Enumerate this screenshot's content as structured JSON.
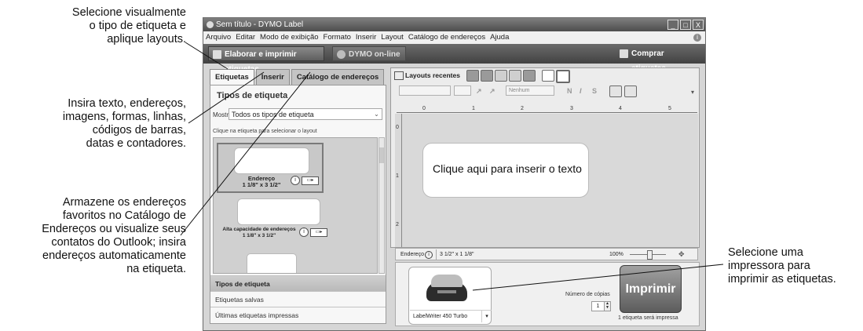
{
  "callouts": {
    "tabs": [
      "Selecione visualmente",
      "o tipo de etiqueta e",
      "aplique layouts."
    ],
    "insert": [
      "Insira texto, endereços,",
      "imagens, formas, linhas,",
      "códigos de barras,",
      "datas e contadores."
    ],
    "addressbook": [
      "Armazene os endereços",
      "favoritos no Catálogo de",
      "Endereços ou visualize seus",
      "contatos do Outlook; insira",
      "endereços automaticamente",
      "na etiqueta."
    ],
    "printer": [
      "Selecione uma",
      "impressora para",
      "imprimir as etiquetas."
    ]
  },
  "window": {
    "title": "Sem título - DYMO Label",
    "controls": [
      "_",
      "□",
      "X"
    ]
  },
  "menu": [
    "Arquivo",
    "Editar",
    "Modo de exibição",
    "Formato",
    "Inserir",
    "Layout",
    "Catálogo de endereços",
    "Ajuda"
  ],
  "toolbar": {
    "design_label": "Elaborar e imprimir etiquetas",
    "online_label": "DYMO on-line",
    "buy_label": "Comprar etiquetas"
  },
  "left": {
    "tabs": [
      "Etiquetas",
      "Inserir",
      "Catálogo de endereços"
    ],
    "heading": "Tipos de etiqueta",
    "show_label": "Mostrar",
    "show_value": "Todos os tipos de etiqueta",
    "hint": "Clique na etiqueta para selecionar o layout",
    "labels": [
      {
        "name": "Endereço",
        "size": "1 1/8\" x 3 1/2\""
      },
      {
        "name": "Alta capacidade de endereços",
        "size": "1 1/8\" x 3 1/2\""
      }
    ],
    "accordion": [
      "Tipos de etiqueta",
      "Etiquetas salvas",
      "Últimas etiquetas impressas"
    ]
  },
  "editor": {
    "recent_layouts": "Layouts recentes",
    "font_none": "Nenhum",
    "style_buttons": [
      "N",
      "I",
      "S"
    ],
    "ruler_marks": [
      "0",
      "1",
      "2",
      "3",
      "4",
      "5"
    ],
    "vruler_marks": [
      "0",
      "1",
      "2"
    ],
    "placeholder_text": "Clique aqui para inserir o texto",
    "status_label": "Endereço",
    "status_size": "3 1/2\" x 1 1/8\"",
    "zoom": "100%"
  },
  "print": {
    "printer_name": "LabelWriter 450 Turbo",
    "copies_label": "Número de cópias",
    "copies_value": "1",
    "button_label": "Imprimir",
    "note": "1 etiqueta será impressa"
  }
}
